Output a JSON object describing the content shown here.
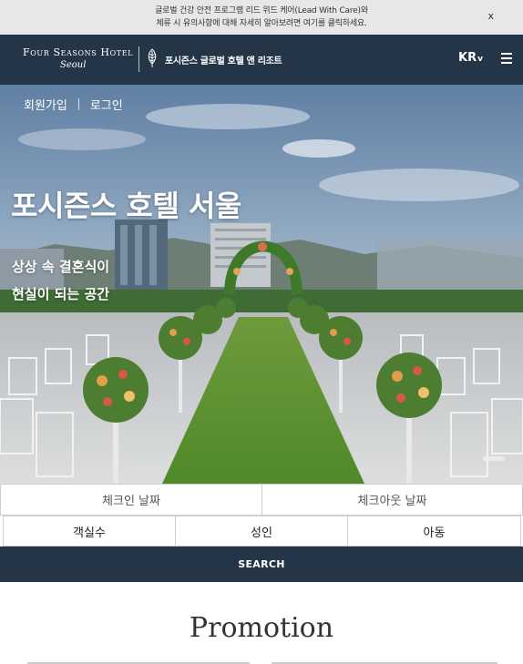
{
  "notice": {
    "line1": "글로벌 건강 안전 프로그램 리드 위드 케어(Lead With Care)와",
    "line2": "체류 시 유의사항에 대해 자세히 알아보려면 여기를 클릭하세요.",
    "close": "x"
  },
  "header": {
    "brand_name": "Four Seasons Hotel",
    "brand_city": "Seoul",
    "brand_sub": "포시즌스 글로벌 호텔 앤 리조트",
    "lang": "KR",
    "lang_caret": "v",
    "menu_icon": "hamburger-icon",
    "logo_icon": "tree-icon",
    "bg_color": "#233547"
  },
  "hero": {
    "signup": "회원가입",
    "login": "로그인",
    "title": "포시즌스 호텔 서울",
    "subtitle_line1": "상상 속 결혼식이",
    "subtitle_line2": "현실이 되는 공간"
  },
  "booking": {
    "checkin": "체크인 날짜",
    "checkout": "체크아웃 날짜",
    "rooms": "객실수",
    "adults": "성인",
    "children": "아동",
    "search": "SEARCH"
  },
  "promotion": {
    "title": "Promotion"
  }
}
